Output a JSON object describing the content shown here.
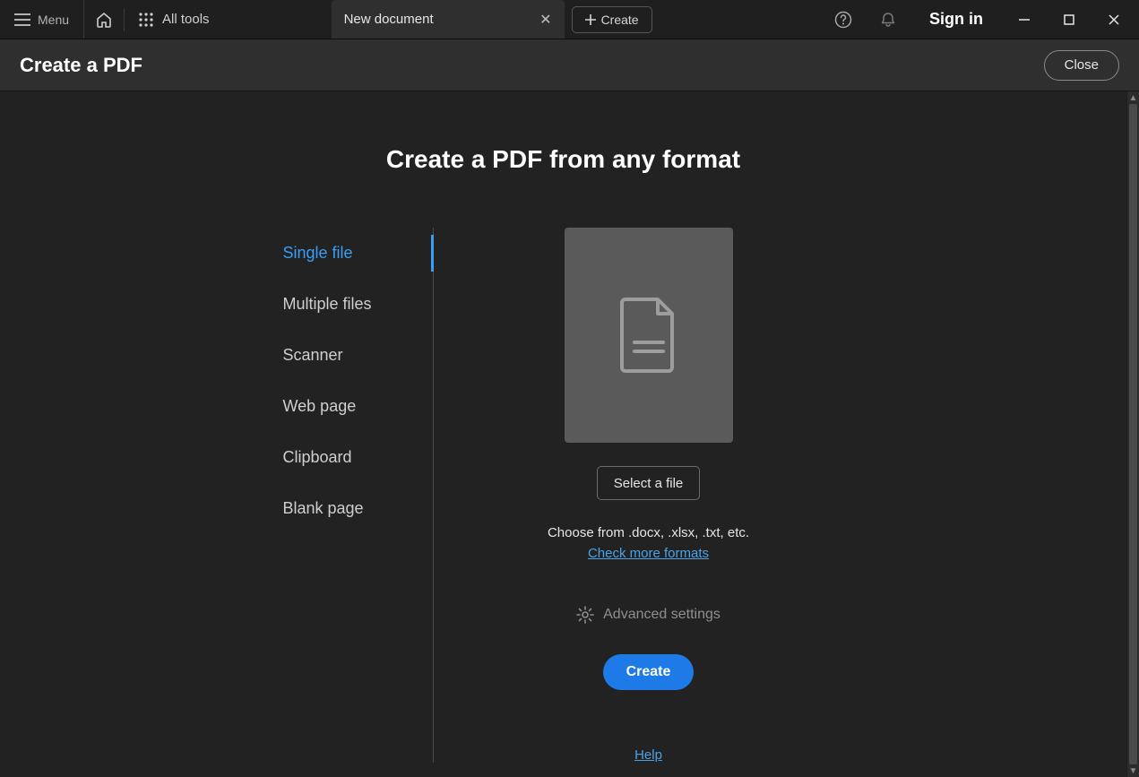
{
  "titlebar": {
    "menu_label": "Menu",
    "all_tools_label": "All tools",
    "tab_label": "New document",
    "create_label": "Create",
    "signin_label": "Sign in"
  },
  "header": {
    "title": "Create a PDF",
    "close_label": "Close"
  },
  "main": {
    "heading": "Create a PDF from any format",
    "sources": [
      {
        "label": "Single file",
        "active": true
      },
      {
        "label": "Multiple files",
        "active": false
      },
      {
        "label": "Scanner",
        "active": false
      },
      {
        "label": "Web page",
        "active": false
      },
      {
        "label": "Clipboard",
        "active": false
      },
      {
        "label": "Blank page",
        "active": false
      }
    ],
    "select_file_label": "Select a file",
    "hint_text": "Choose from .docx, .xlsx, .txt, etc.",
    "check_formats_label": "Check more formats",
    "advanced_settings_label": "Advanced settings",
    "create_button_label": "Create",
    "help_label": "Help"
  },
  "colors": {
    "accent": "#3b9ef5",
    "primary_button": "#1e7ae6",
    "bg_dark": "#222222"
  }
}
